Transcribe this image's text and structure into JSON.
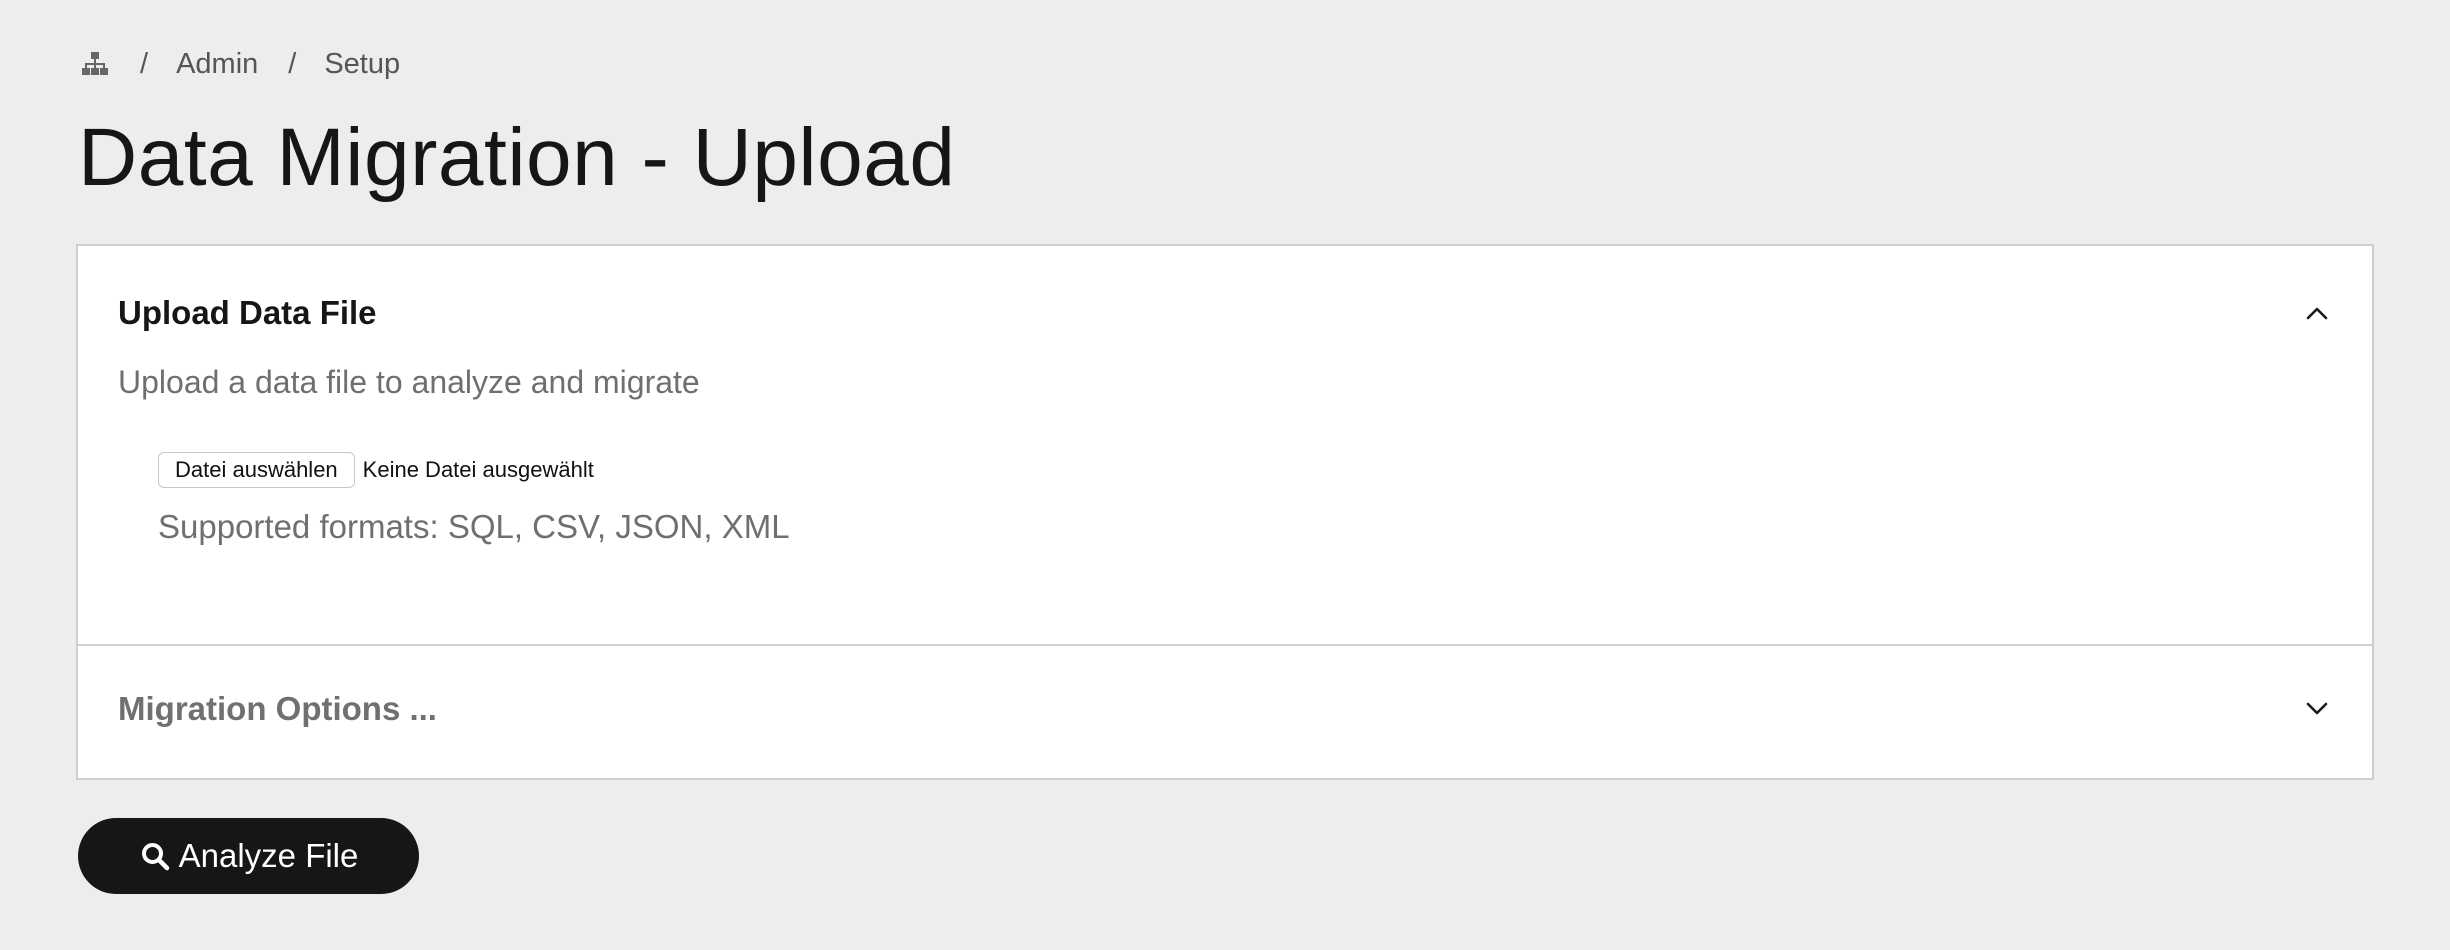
{
  "breadcrumb": {
    "home_icon": "sitemap-icon",
    "separator": "/",
    "items": [
      "Admin",
      "Setup"
    ]
  },
  "page": {
    "title": "Data Migration - Upload"
  },
  "upload_section": {
    "title": "Upload Data File",
    "description": "Upload a data file to analyze and migrate",
    "file_button_label": "Datei auswählen",
    "file_status": "Keine Datei ausgewählt",
    "supported_formats": "Supported formats: SQL, CSV, JSON, XML",
    "expanded": true,
    "chevron_icon": "chevron-up-icon"
  },
  "options_section": {
    "title": "Migration Options ...",
    "expanded": false,
    "chevron_icon": "chevron-down-icon"
  },
  "actions": {
    "analyze_label": "Analyze File",
    "analyze_icon": "search-icon"
  },
  "colors": {
    "background": "#ededed",
    "panel": "#ffffff",
    "primary_button": "#161616",
    "muted_text": "#6f6f6f"
  }
}
